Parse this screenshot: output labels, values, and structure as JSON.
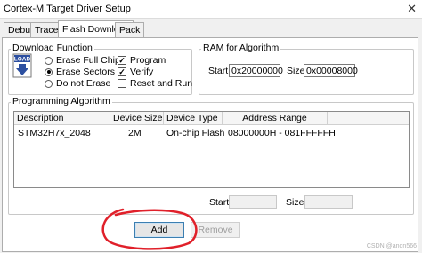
{
  "window": {
    "title": "Cortex-M Target Driver Setup",
    "close_glyph": "✕"
  },
  "tabs": [
    {
      "label": "Debug"
    },
    {
      "label": "Trace"
    },
    {
      "label": "Flash Download",
      "active": true
    },
    {
      "label": "Pack"
    }
  ],
  "download_function": {
    "title": "Download Function",
    "icon_text": "LOAD",
    "radios": [
      {
        "label": "Erase Full Chip",
        "selected": false
      },
      {
        "label": "Erase Sectors",
        "selected": true
      },
      {
        "label": "Do not Erase",
        "selected": false
      }
    ],
    "checks": [
      {
        "label": "Program",
        "checked": true
      },
      {
        "label": "Verify",
        "checked": true
      },
      {
        "label": "Reset and Run",
        "checked": false
      }
    ],
    "check_glyph": "✓"
  },
  "ram": {
    "title": "RAM for Algorithm",
    "start_label": "Start:",
    "start_value": "0x20000000",
    "size_label": "Size:",
    "size_value": "0x00008000"
  },
  "programming": {
    "title": "Programming Algorithm",
    "columns": [
      "Description",
      "Device Size",
      "Device Type",
      "Address Range"
    ],
    "rows": [
      {
        "description": "STM32H7x_2048",
        "size": "2M",
        "type": "On-chip Flash",
        "range": "08000000H - 081FFFFFH"
      }
    ],
    "start_label": "Start:",
    "size_label": "Size:",
    "start_value": "",
    "size_value": ""
  },
  "buttons": {
    "add": "Add",
    "remove": "Remove"
  },
  "colors": {
    "annotation": "#e0202a",
    "accent": "#3c7fb1"
  },
  "watermark": "CSDN @anon566"
}
